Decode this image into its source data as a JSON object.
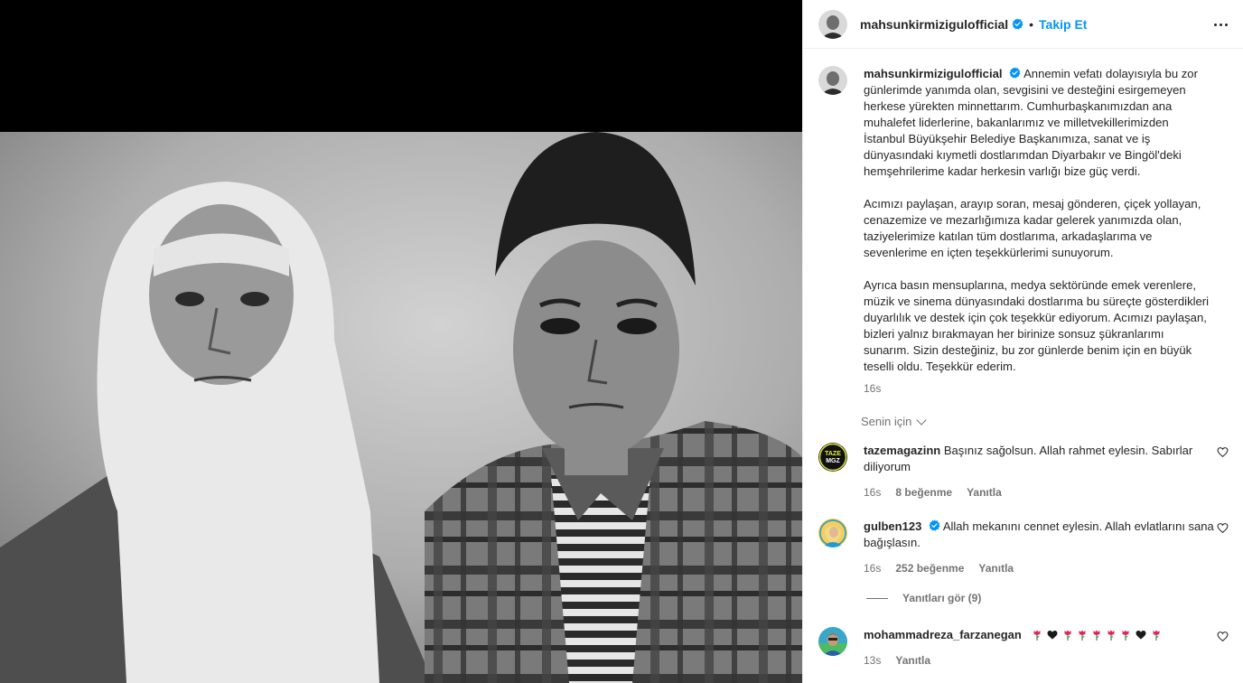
{
  "header": {
    "username": "mahsunkirmizigulofficial",
    "follow_label": "Takip Et",
    "separator": "•"
  },
  "caption": {
    "username": "mahsunkirmizigulofficial",
    "paragraph1": "Annemin vefatı dolayısıyla bu zor günlerimde yanımda olan, sevgisini ve desteğini esirgemeyen herkese yürekten minnettarım. Cumhurbaşkanımızdan ana muhalefet liderlerine, bakanlarımız ve milletvekillerimizden İstanbul Büyükşehir Belediye Başkanımıza, sanat ve iş dünyasındaki kıymetli dostlarımdan Diyarbakır ve Bingöl'deki hemşehrilerime kadar herkesin varlığı bize güç verdi.",
    "paragraph2": "Acımızı paylaşan, arayıp soran, mesaj gönderen, çiçek yollayan, cenazemize ve mezarlığımıza kadar gelerek yanımızda olan, taziyelerimize katılan tüm dostlarıma, arkadaşlarıma ve sevenlerime en içten teşekkürlerimi sunuyorum.",
    "paragraph3": "Ayrıca basın mensuplarına, medya sektöründe emek verenlere, müzik ve sinema dünyasındaki dostlarıma bu süreçte gösterdikleri duyarlılık ve destek için çok teşekkür ediyorum. Acımızı paylaşan, bizleri yalnız bırakmayan her birinize sonsuz şükranlarımı sunarım. Sizin desteğiniz, bu zor günlerde benim için en büyük teselli oldu. Teşekkür ederim.",
    "time": "16s"
  },
  "for_you_label": "Senin için",
  "comments": [
    {
      "username": "tazemagazinn",
      "text": "Başınız sağolsun. Allah rahmet eylesin. Sabırlar diliyorum",
      "time": "16s",
      "likes": "8 beğenme",
      "reply_label": "Yanıtla",
      "avatar_text": "TAZE MGZ"
    },
    {
      "username": "gulben123",
      "text": "Allah mekanını cennet eylesin. Allah evlatlarını sana bağışlasın.",
      "time": "16s",
      "likes": "252 beğenme",
      "reply_label": "Yanıtla"
    },
    {
      "username": "mohammadreza_farzanegan",
      "text": "",
      "time": "13s",
      "reply_label": "Yanıtla",
      "emoji_sequence": [
        "rose",
        "black-heart",
        "rose",
        "rose",
        "rose",
        "rose",
        "rose",
        "black-heart",
        "rose"
      ]
    }
  ],
  "view_replies_label": "Yanıtları gör (9)",
  "colors": {
    "accent_blue": "#0095f6",
    "verified_blue": "#0095f6",
    "text": "#262626",
    "muted": "#737373"
  },
  "icons": [
    "verified-badge-icon",
    "more-options-icon",
    "chevron-down-icon",
    "heart-icon",
    "rose-emoji-icon",
    "black-heart-emoji-icon"
  ]
}
